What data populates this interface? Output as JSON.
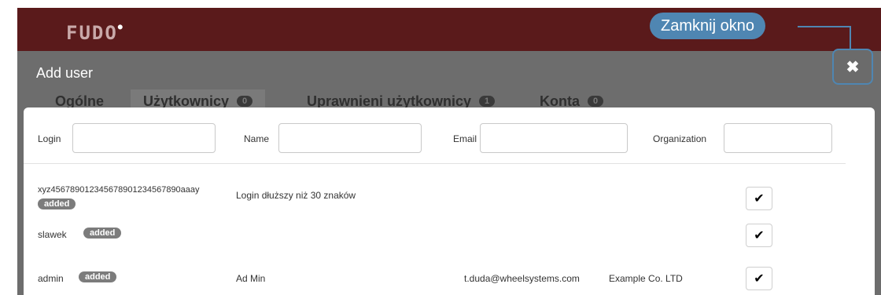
{
  "app": {
    "logo": "FUDO"
  },
  "modal": {
    "title": "Add user",
    "tabs": [
      {
        "label": "Ogólne",
        "count": ""
      },
      {
        "label": "Użytkownicy",
        "count": "0"
      },
      {
        "label": "Uprawnieni użytkownicy",
        "count": "1"
      },
      {
        "label": "Konta",
        "count": "0"
      }
    ],
    "filters": {
      "login_label": "Login",
      "name_label": "Name",
      "email_label": "Email",
      "organization_label": "Organization",
      "login_value": "",
      "name_value": "",
      "email_value": "",
      "organization_value": ""
    },
    "rows": [
      {
        "login": "xyz45678901234567890123456789​0aaay",
        "badge": "added",
        "name": "Login dłuższy niż 30 znaków",
        "email": "",
        "organization": ""
      },
      {
        "login": "slawek",
        "badge": "added",
        "name": "",
        "email": "",
        "organization": ""
      },
      {
        "login": "admin",
        "badge": "added",
        "name": "Ad Min",
        "email": "t.duda@wheelsystems.com",
        "organization": "Example Co. LTD"
      }
    ]
  },
  "annotation": {
    "callout_text": "Zamknij okno",
    "accent_color": "#4f86b2"
  },
  "icons": {
    "close": "close-icon",
    "check": "check-icon"
  }
}
